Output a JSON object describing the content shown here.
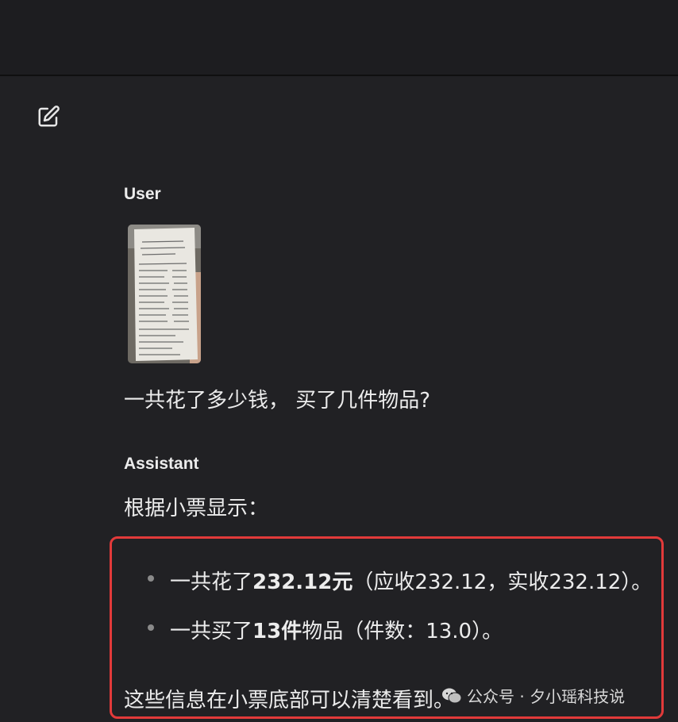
{
  "messages": {
    "user": {
      "role": "User",
      "text": "一共花了多少钱， 买了几件物品?"
    },
    "assistant": {
      "role": "Assistant",
      "intro": "根据小票显示：",
      "bullets": [
        {
          "prefix": "一共花了",
          "bold": "232.12元",
          "suffix": "（应收232.12，实收232.12）。"
        },
        {
          "prefix": "一共买了",
          "bold": "13件",
          "suffix": "物品（件数：13.0）。"
        }
      ],
      "closing": "这些信息在小票底部可以清楚看到。"
    }
  },
  "watermark": {
    "text": "公众号 · 夕小瑶科技说",
    "icon": "wechat-icon"
  },
  "icons": {
    "edit": "edit-icon"
  },
  "colors": {
    "background": "#212124",
    "highlight": "#e23a3a"
  }
}
